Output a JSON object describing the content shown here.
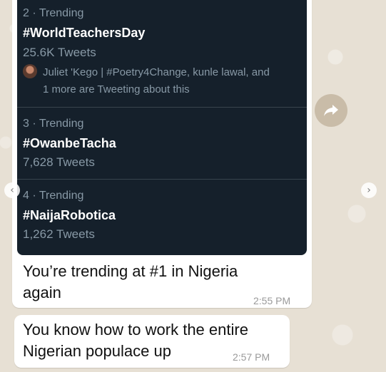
{
  "trends": [
    {
      "meta": "2 · Trending",
      "tag": "#WorldTeachersDay",
      "count": "25.6K Tweets",
      "context_line1": "Juliet 'Kego | #Poetry4Change, kunle lawal, and",
      "context_line2": "1 more are Tweeting about this"
    },
    {
      "meta": "3 · Trending",
      "tag": "#OwanbeTacha",
      "count": "7,628 Tweets"
    },
    {
      "meta": "4 · Trending",
      "tag": "#NaijaRobotica",
      "count": "1,262 Tweets"
    }
  ],
  "messages": [
    {
      "line1": "You’re trending at #1 in Nigeria",
      "line2": "again",
      "time": "2:55 PM"
    },
    {
      "line1": "You know how to work the entire",
      "line2": "Nigerian populace up",
      "time": "2:57 PM"
    }
  ],
  "icons": {
    "forward": "forward-arrow-icon",
    "prev": "chevron-left-icon",
    "next": "chevron-right-icon"
  },
  "colors": {
    "twitter_bg": "#15202b",
    "wallpaper": "#e7e0d4",
    "bubble": "#ffffff"
  }
}
